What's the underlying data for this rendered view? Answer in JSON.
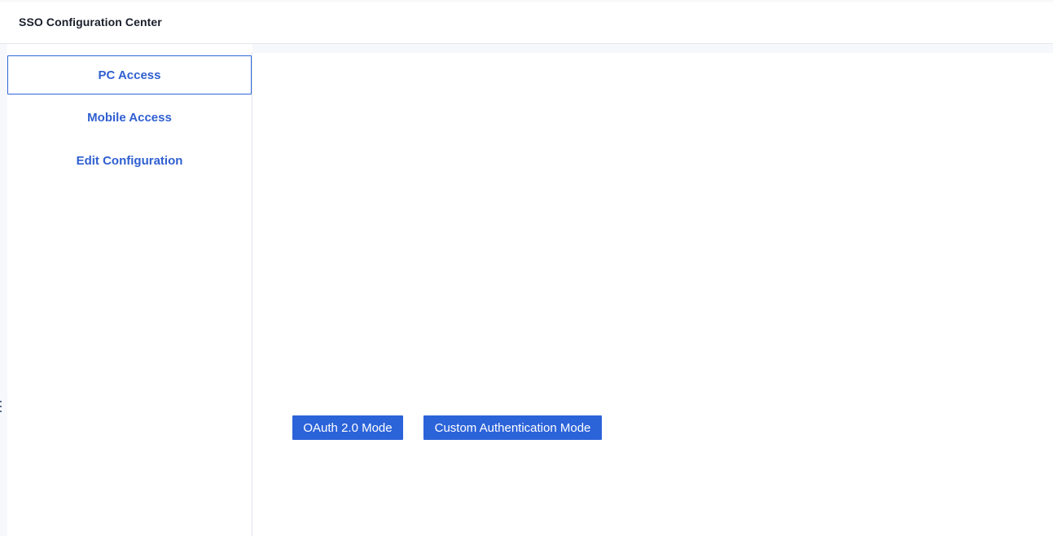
{
  "header": {
    "title": "SSO Configuration Center"
  },
  "sidebar": {
    "items": [
      {
        "label": "PC Access",
        "active": true
      },
      {
        "label": "Mobile Access",
        "active": false
      },
      {
        "label": "Edit Configuration",
        "active": false
      }
    ]
  },
  "main": {
    "buttons": {
      "oauth_label": "OAuth 2.0 Mode",
      "custom_label": "Custom Authentication Mode"
    }
  },
  "colors": {
    "accent": "#2b63d9",
    "nav_text": "#2f5fd0",
    "title_text": "#1a1f2b",
    "border": "#dfe3ea"
  },
  "icons": {
    "drag_handle": "drag-handle-icon"
  }
}
